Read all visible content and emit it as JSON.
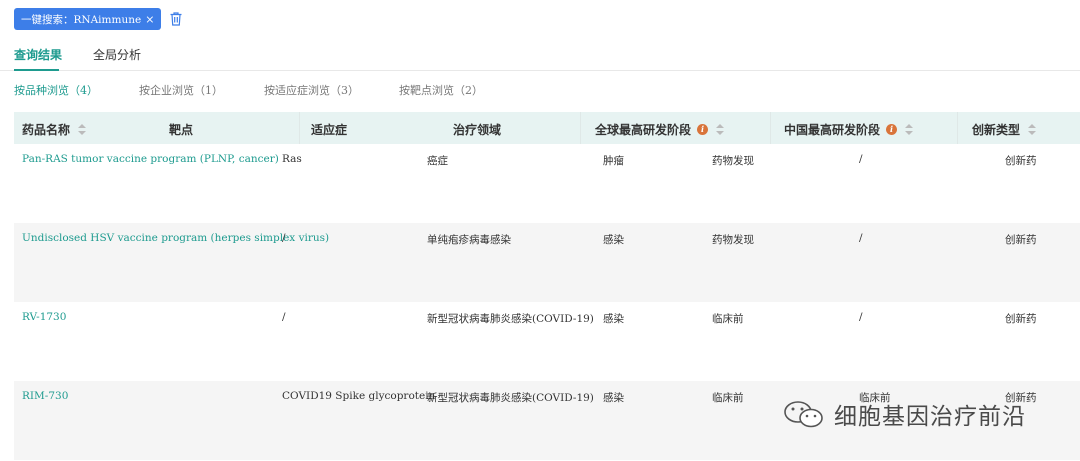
{
  "search_chip": {
    "label": "一键搜索：RNAimmune",
    "close": "×"
  },
  "tabs": [
    {
      "label": "查询结果"
    },
    {
      "label": "全局分析"
    }
  ],
  "subtabs": [
    {
      "label": "按品种浏览（4）"
    },
    {
      "label": "按企业浏览（1）"
    },
    {
      "label": "按适应症浏览（3）"
    },
    {
      "label": "按靶点浏览（2）"
    }
  ],
  "columns": [
    {
      "label": "药品名称"
    },
    {
      "label": "靶点"
    },
    {
      "label": "适应症"
    },
    {
      "label": "治疗领域"
    },
    {
      "label": "全球最高研发阶段"
    },
    {
      "label": "中国最高研发阶段"
    },
    {
      "label": "创新类型"
    }
  ],
  "info_glyph": "i",
  "rows": [
    {
      "name": "Pan-RAS tumor vaccine program (PLNP, cancer)",
      "target": "Ras",
      "indication": "癌症",
      "area": "肿瘤",
      "global": "药物发现",
      "china": "/",
      "type": "创新药"
    },
    {
      "name": "Undisclosed HSV vaccine program (herpes simplex virus)",
      "target": "/",
      "indication": "单纯疱疹病毒感染",
      "area": "感染",
      "global": "药物发现",
      "china": "/",
      "type": "创新药"
    },
    {
      "name": "RV-1730",
      "target": "/",
      "indication": "新型冠状病毒肺炎感染(COVID-19)",
      "area": "感染",
      "global": "临床前",
      "china": "/",
      "type": "创新药"
    },
    {
      "name": "RIM-730",
      "target": "COVID19 Spike glycoprotein",
      "indication": "新型冠状病毒肺炎感染(COVID-19)",
      "area": "感染",
      "global": "临床前",
      "china": "临床前",
      "type": "创新药"
    }
  ],
  "watermark": {
    "text": "细胞基因治疗前沿"
  }
}
